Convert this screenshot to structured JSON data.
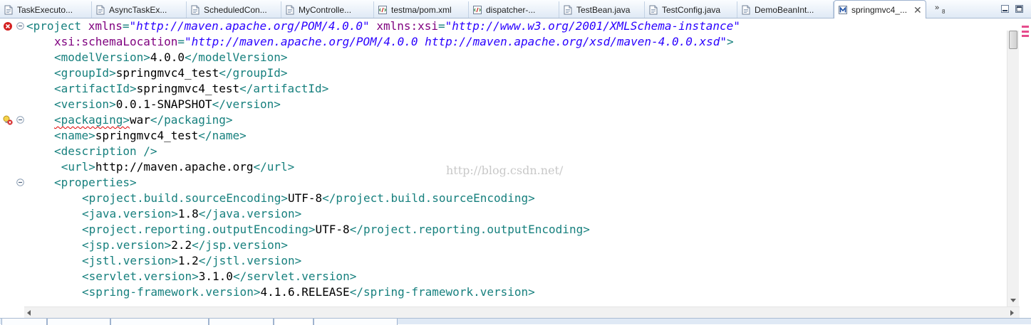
{
  "editor_tabs": [
    {
      "label": "TaskExecuto...",
      "icon": "java-file-icon",
      "active": false
    },
    {
      "label": "AsyncTaskEx...",
      "icon": "java-file-icon",
      "active": false
    },
    {
      "label": "ScheduledCon...",
      "icon": "java-file-icon",
      "active": false
    },
    {
      "label": "MyControlle...",
      "icon": "java-file-icon",
      "active": false
    },
    {
      "label": "testma/pom.xml",
      "icon": "xml-file-icon",
      "active": false
    },
    {
      "label": "dispatcher-...",
      "icon": "xml-file-icon",
      "active": false
    },
    {
      "label": "TestBean.java",
      "icon": "java-file-icon",
      "active": false
    },
    {
      "label": "TestConfig.java",
      "icon": "java-file-icon",
      "active": false
    },
    {
      "label": "DemoBeanInt...",
      "icon": "java-file-icon",
      "active": false
    },
    {
      "label": "springmvc4_...",
      "icon": "maven-pom-icon",
      "active": true
    }
  ],
  "tab_overflow_count": "8",
  "code_lines": [
    {
      "marker": "error",
      "fold": true,
      "indent": 0,
      "tokens": [
        [
          "t",
          "<project "
        ],
        [
          "a",
          "xmlns"
        ],
        [
          "t",
          "="
        ],
        [
          "v",
          "\"http://maven.apache.org/POM/4.0.0\""
        ],
        [
          "x",
          " "
        ],
        [
          "a",
          "xmlns:xsi"
        ],
        [
          "t",
          "="
        ],
        [
          "v",
          "\"http://www.w3.org/2001/XMLSchema-instance\""
        ]
      ]
    },
    {
      "marker": "",
      "fold": false,
      "indent": 4,
      "tokens": [
        [
          "a",
          "xsi:schemaLocation"
        ],
        [
          "t",
          "="
        ],
        [
          "v",
          "\"http://maven.apache.org/POM/4.0.0 http://maven.apache.org/xsd/maven-4.0.0.xsd\""
        ],
        [
          "t",
          ">"
        ]
      ]
    },
    {
      "marker": "",
      "fold": false,
      "indent": 4,
      "tokens": [
        [
          "t",
          "<modelVersion>"
        ],
        [
          "x",
          "4.0.0"
        ],
        [
          "t",
          "</modelVersion>"
        ]
      ]
    },
    {
      "marker": "",
      "fold": false,
      "indent": 4,
      "tokens": [
        [
          "t",
          "<groupId>"
        ],
        [
          "x",
          "springmvc4_test"
        ],
        [
          "t",
          "</groupId>"
        ]
      ]
    },
    {
      "marker": "",
      "fold": false,
      "indent": 4,
      "tokens": [
        [
          "t",
          "<artifactId>"
        ],
        [
          "x",
          "springmvc4_test"
        ],
        [
          "t",
          "</artifactId>"
        ]
      ]
    },
    {
      "marker": "",
      "fold": false,
      "indent": 4,
      "tokens": [
        [
          "t",
          "<version>"
        ],
        [
          "x",
          "0.0.1-SNAPSHOT"
        ],
        [
          "t",
          "</version>"
        ]
      ]
    },
    {
      "marker": "warning",
      "fold": true,
      "indent": 4,
      "tokens": [
        [
          "e",
          "<packaging>"
        ],
        [
          "x",
          "war"
        ],
        [
          "t",
          "</packaging>"
        ]
      ]
    },
    {
      "marker": "",
      "fold": false,
      "indent": 4,
      "tokens": [
        [
          "t",
          "<name>"
        ],
        [
          "x",
          "springmvc4_test"
        ],
        [
          "t",
          "</name>"
        ]
      ]
    },
    {
      "marker": "",
      "fold": false,
      "indent": 4,
      "tokens": [
        [
          "t",
          "<description />"
        ]
      ]
    },
    {
      "marker": "",
      "fold": false,
      "indent": 5,
      "tokens": [
        [
          "t",
          "<url>"
        ],
        [
          "x",
          "http://maven.apache.org"
        ],
        [
          "t",
          "</url>"
        ]
      ]
    },
    {
      "marker": "",
      "fold": true,
      "indent": 4,
      "tokens": [
        [
          "t",
          "<properties>"
        ]
      ]
    },
    {
      "marker": "",
      "fold": false,
      "indent": 8,
      "tokens": [
        [
          "t",
          "<project.build.sourceEncoding>"
        ],
        [
          "x",
          "UTF-8"
        ],
        [
          "t",
          "</project.build.sourceEncoding>"
        ]
      ]
    },
    {
      "marker": "",
      "fold": false,
      "indent": 8,
      "tokens": [
        [
          "t",
          "<java.version>"
        ],
        [
          "x",
          "1.8"
        ],
        [
          "t",
          "</java.version>"
        ]
      ]
    },
    {
      "marker": "",
      "fold": false,
      "indent": 8,
      "tokens": [
        [
          "t",
          "<project.reporting.outputEncoding>"
        ],
        [
          "x",
          "UTF-8"
        ],
        [
          "t",
          "</project.reporting.outputEncoding>"
        ]
      ]
    },
    {
      "marker": "",
      "fold": false,
      "indent": 8,
      "tokens": [
        [
          "t",
          "<jsp.version>"
        ],
        [
          "x",
          "2.2"
        ],
        [
          "t",
          "</jsp.version>"
        ]
      ]
    },
    {
      "marker": "",
      "fold": false,
      "indent": 8,
      "tokens": [
        [
          "t",
          "<jstl.version>"
        ],
        [
          "x",
          "1.2"
        ],
        [
          "t",
          "</jstl.version>"
        ]
      ]
    },
    {
      "marker": "",
      "fold": false,
      "indent": 8,
      "tokens": [
        [
          "t",
          "<servlet.version>"
        ],
        [
          "x",
          "3.1.0"
        ],
        [
          "t",
          "</servlet.version>"
        ]
      ]
    },
    {
      "marker": "",
      "fold": false,
      "indent": 8,
      "tokens": [
        [
          "t",
          "<spring-framework.version>"
        ],
        [
          "x",
          "4.1.6.RELEASE"
        ],
        [
          "t",
          "</spring-framework.version>"
        ]
      ]
    }
  ],
  "watermark": "http://blog.csdn.net/",
  "bottom_tabs": [
    {
      "label": "",
      "active": false
    },
    {
      "label": "",
      "active": false
    },
    {
      "label": "",
      "active": false
    },
    {
      "label": "",
      "active": false
    },
    {
      "label": "",
      "active": true
    },
    {
      "label": "",
      "active": false
    }
  ],
  "colors": {
    "tag": "#17807e",
    "attribute": "#7f007f",
    "value": "#2a00ff",
    "text": "#000000",
    "error": "#d42020",
    "overview_marker": "#e64c8d"
  }
}
